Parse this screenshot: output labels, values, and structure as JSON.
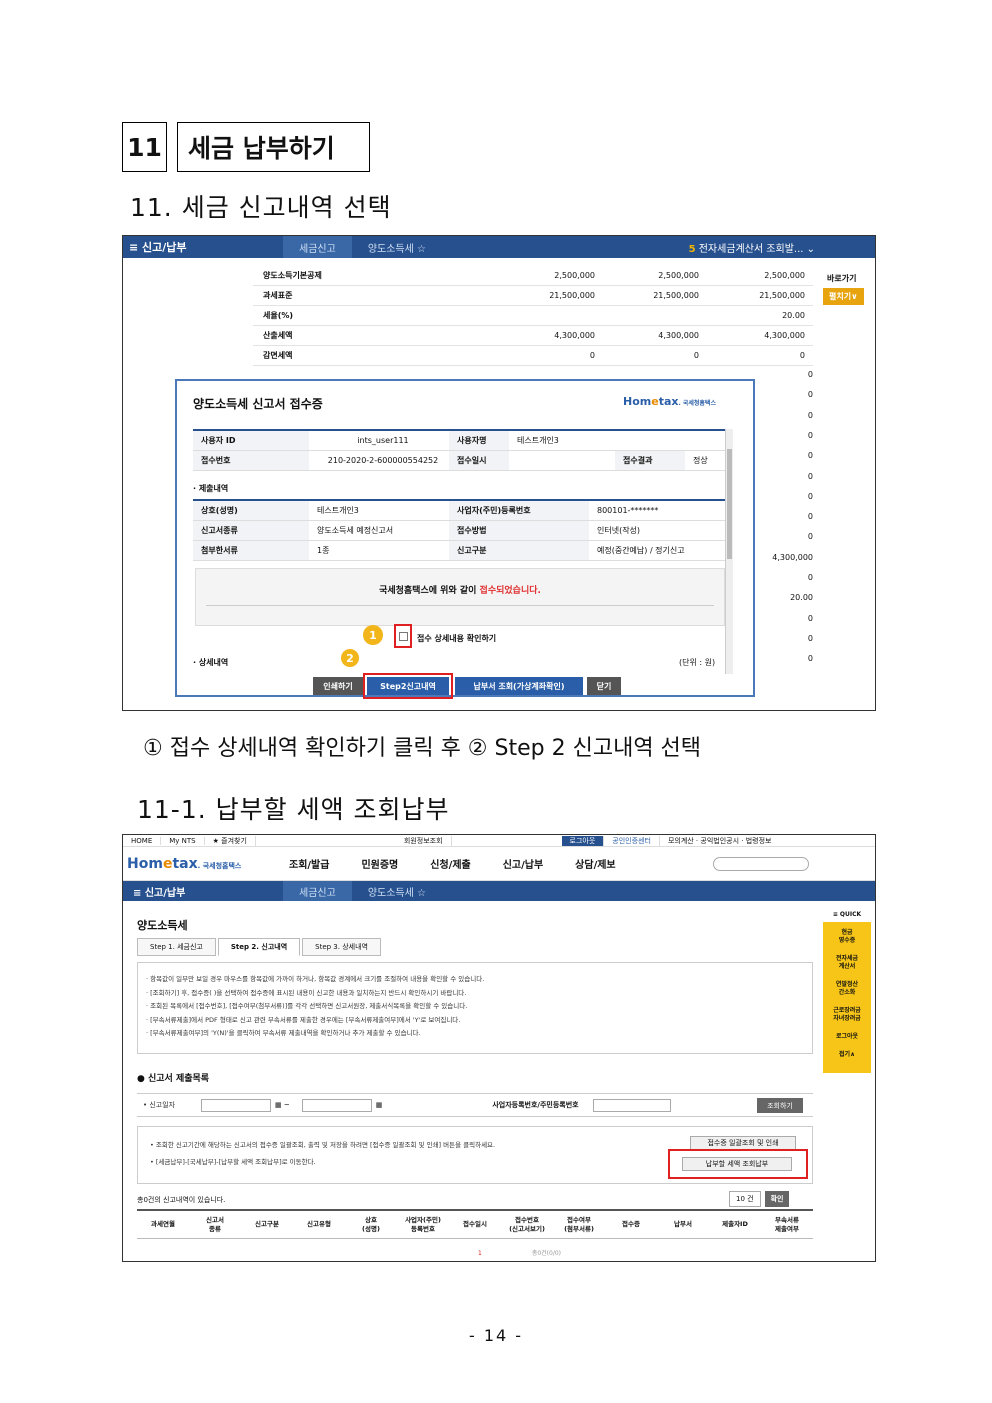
{
  "section": {
    "number": "11",
    "title": "세금 납부하기"
  },
  "heading1": "11. 세금 신고내역 선택",
  "shot1": {
    "nav_menu": "≡ 신고/납부",
    "crumb1": "세금신고",
    "crumb2": "양도소득세 ☆",
    "right_text": "전자세금계산서 조회발...",
    "right_num": "5",
    "rows": [
      {
        "label": "양도소득기본공제",
        "v1": "2,500,000",
        "v2": "2,500,000",
        "v3": "2,500,000"
      },
      {
        "label": "과세표준",
        "v1": "21,500,000",
        "v2": "21,500,000",
        "v3": "21,500,000"
      },
      {
        "label": "세율(%)",
        "v1": "",
        "v2": "",
        "v3": "20.00"
      },
      {
        "label": "산출세액",
        "v1": "4,300,000",
        "v2": "4,300,000",
        "v3": "4,300,000"
      },
      {
        "label": "감면세액",
        "v1": "0",
        "v2": "0",
        "v3": "0"
      }
    ],
    "right_values": [
      "0",
      "0",
      "0",
      "0",
      "0",
      "0",
      "0",
      "0",
      "0",
      "4,300,000",
      "0",
      "20.00",
      "0",
      "0",
      "0"
    ],
    "side_link": "바로가기",
    "side_button": "펼치기∨",
    "modal": {
      "title": "양도소득세 신고서 접수증",
      "logo_home": "Hom",
      "logo_e": "e",
      "logo_tax": "tax",
      "logo_sub": ". 국세청홈택스",
      "rows1": [
        {
          "l1": "사용자 ID",
          "c1": "ints_user111",
          "l2": "사용자명",
          "c2": "테스트개인3",
          "l3": "",
          "c3": ""
        },
        {
          "l1": "접수번호",
          "c1": "210-2020-2-600000554252",
          "l2": "접수일시",
          "c2": "",
          "l3": "접수결과",
          "c3": "정상"
        }
      ],
      "sub_submit": "· 제출내역",
      "rows2": [
        {
          "l1": "상호(성명)",
          "c1": "테스트개인3",
          "l2": "사업자(주민)등록번호",
          "c2": "800101-*******"
        },
        {
          "l1": "신고서종류",
          "c1": "양도소득세 예정신고서",
          "l2": "접수방법",
          "c2": "인터넷(작성)"
        },
        {
          "l1": "첨부한서류",
          "c1": "1종",
          "l2": "신고구분",
          "c2": "예정(중간예납) / 정기신고"
        }
      ],
      "notice_pre": "국세청홈택스에 위와 같이 ",
      "notice_em": "접수되었습니다.",
      "badge1": "1",
      "badge2": "2",
      "check_label": "접수 상세내용 확인하기",
      "sub_detail": "· 상세내역",
      "unit": "(단위 : 원)",
      "btn_print": "인쇄하기",
      "btn_step2": "Step2신고내역",
      "btn_pay": "납부서 조회(가상계좌확인)",
      "btn_close": "닫기"
    }
  },
  "caption": "① 접수 상세내역 확인하기 클릭 후 ② Step 2 신고내역 선택",
  "heading2": "11-1. 납부할 세액 조회납부",
  "shot2": {
    "top_links": [
      "HOME",
      "My NTS",
      "★ 즐겨찾기"
    ],
    "top_middle": "회원정보조회",
    "top_right": [
      "로그아웃",
      "공인인증센터",
      "모의계산 · 공익법인공시 · 법령정보"
    ],
    "logo_sub": ". 국세청홈택스",
    "menus": [
      "조회/발급",
      "민원증명",
      "신청/제출",
      "신고/납부",
      "상담/제보"
    ],
    "nav_menu": "≡ 신고/납부",
    "crumb1": "세금신고",
    "crumb2": "양도소득세 ☆",
    "page_title": "양도소득세",
    "tabs": [
      "Step 1. 세금신고",
      "Step 2. 신고내역",
      "Step 3. 상세내역"
    ],
    "info_lines": [
      "· 항목값이 일부만 보일 경우 마우스를 항목값에 가까이 하거나, 항목값 경계에서 크기를 조절하여 내용을 확인할 수 있습니다.",
      "· [조회하기] 후, 접수증(   )을 선택하여 접수증에 표시된 내용이 신고한 내용과 일치하는지 반드시 확인하시기 바랍니다.",
      "· 조회된 목록에서 [접수번호], [접수여부(첨부서류)]를 각각 선택하면 신고서원장, 제출서식목록을 확인할 수 있습니다.",
      "· [부속서류제출]에서 PDF 형태로 신고 관련 부속서류를 제출한 경우에는 [부속서류제출여부]에서 'Y'로 보여집니다.",
      "· [부속서류제출여부]의 'Y(N)'을 클릭하여 부속서류 제출내역을 확인하거나 추가 제출할 수 있습니다."
    ],
    "list_title": "● 신고서 제출목록",
    "search_label": "• 신고일자",
    "bizno_label": "사업자등록번호/주민등록번호",
    "search_btn": "조회하기",
    "hint_lines": [
      "• 조회한 신고기간에 해당하는 신고서의 접수증 일괄조회, 출력 및 저장을 하려면 [접수증 일괄조회 및 인쇄] 버튼을 클릭하세요.",
      "• [세금납부]-[국세납부]-[납부할 세액 조회납부]로 이동한다."
    ],
    "btn_receipt": "접수증 일괄조회 및 인쇄",
    "btn_pay": "납부할 세액 조회납부",
    "count": "총0건의 신고내역이 있습니다.",
    "perpage": "10 건",
    "perpage_btn": "확인",
    "columns": [
      "과세연월",
      "신고서\n종류",
      "신고구분",
      "신고유형",
      "상호\n(성명)",
      "사업자(주민)\n등록번호",
      "접수일시",
      "접수번호\n(신고서보기)",
      "접수여부\n(첨부서류)",
      "접수증",
      "납부서",
      "제출자ID",
      "부속서류\n제출여부"
    ],
    "pager_num": "1",
    "pager_total": "총0건(0/0)",
    "quick_label": "≡ QUICK",
    "quick_items": [
      "현금\n영수증",
      "전자세금\n계산서",
      "연말정산\n간소화",
      "근로장려금\n자녀장려금",
      "로그아웃"
    ],
    "quick_fold": "접기∧"
  },
  "footer": "- 14 -"
}
